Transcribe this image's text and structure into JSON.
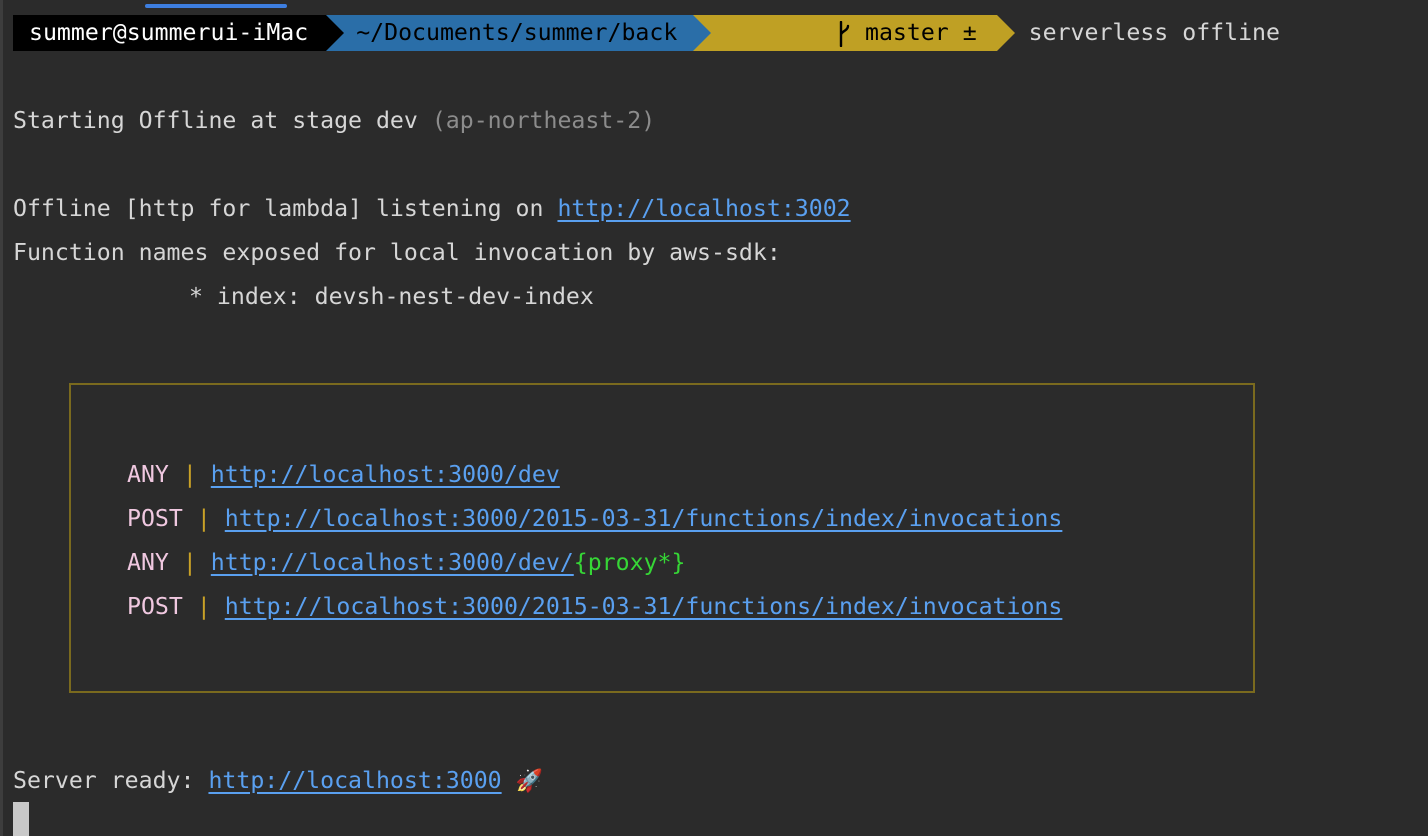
{
  "prompt": {
    "user_host": "summer@summerui-iMac",
    "directory": "~/Documents/summer/back",
    "branch_icon": "git-branch-icon",
    "branch": "master ±",
    "command": "serverless offline"
  },
  "output": {
    "starting": "Starting Offline at stage dev",
    "region": "(ap-northeast-2)",
    "listening_prefix": "Offline [http for lambda] listening on",
    "listening_url": "http://localhost:3002",
    "functions_header": "Function names exposed for local invocation by aws-sdk:",
    "function_item": "* index: devsh-nest-dev-index",
    "routes": [
      {
        "method": "ANY",
        "url": "http://localhost:3000/dev",
        "suffix": ""
      },
      {
        "method": "POST",
        "url": "http://localhost:3000/2015-03-31/functions/index/invocations",
        "suffix": ""
      },
      {
        "method": "ANY",
        "url": "http://localhost:3000/dev/",
        "suffix": "{proxy*}"
      },
      {
        "method": "POST",
        "url": "http://localhost:3000/2015-03-31/functions/index/invocations",
        "suffix": ""
      }
    ],
    "route_separator": "|",
    "server_ready_prefix": "Server ready:",
    "server_ready_url": "http://localhost:3000",
    "rocket": "🚀"
  }
}
